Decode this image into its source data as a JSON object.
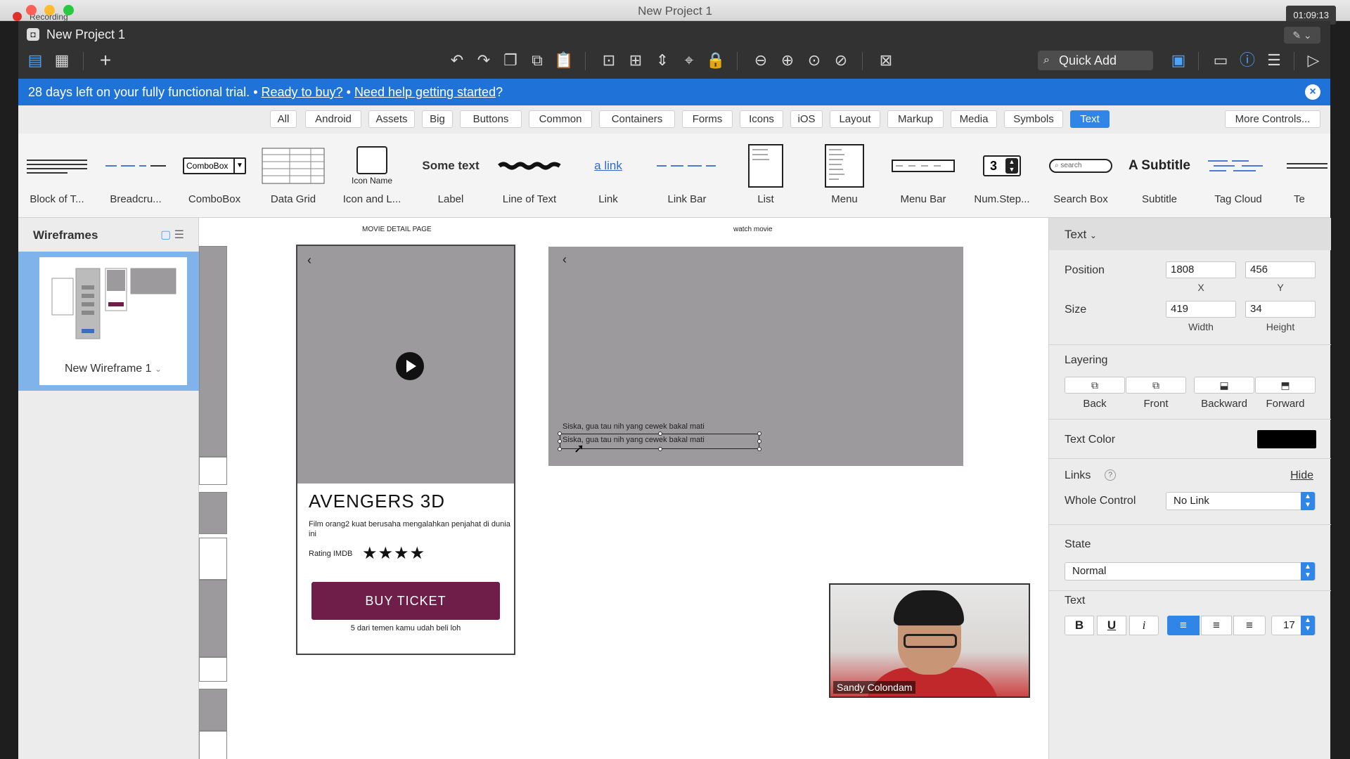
{
  "titlebar": {
    "recording": "Recording",
    "title": "New Project 1",
    "clock": "01:09:13"
  },
  "header": {
    "project_title": "New Project 1",
    "quick_add": "Quick Add",
    "edit_icon": "pencil-icon"
  },
  "trial": {
    "text": "28 days left on your fully functional trial.",
    "sep1": "•",
    "buy": "Ready to buy?",
    "sep2": "•",
    "help": "Need help getting started",
    "help_q": "?"
  },
  "filters": {
    "items": [
      "All",
      "Android",
      "Assets",
      "Big",
      "Buttons",
      "Common",
      "Containers",
      "Forms",
      "Icons",
      "iOS",
      "Layout",
      "Markup",
      "Media",
      "Symbols",
      "Text"
    ],
    "active": "Text",
    "more": "More Controls..."
  },
  "library": {
    "items": [
      {
        "label": "Block of T..."
      },
      {
        "label": "Breadcru..."
      },
      {
        "label": "ComboBox",
        "thumb": "ComboBox"
      },
      {
        "label": "Data Grid"
      },
      {
        "label": "Icon and L...",
        "thumb": "Icon Name"
      },
      {
        "label": "Label",
        "thumb": "Some text"
      },
      {
        "label": "Line of Text"
      },
      {
        "label": "Link",
        "thumb": "a link"
      },
      {
        "label": "Link Bar"
      },
      {
        "label": "List"
      },
      {
        "label": "Menu"
      },
      {
        "label": "Menu Bar"
      },
      {
        "label": "Num.Step...",
        "thumb": "3"
      },
      {
        "label": "Search Box",
        "thumb": "search"
      },
      {
        "label": "Subtitle",
        "thumb": "A Subtitle"
      },
      {
        "label": "Tag Cloud"
      },
      {
        "label": "Te"
      }
    ]
  },
  "wireframes": {
    "title": "Wireframes",
    "item": "New Wireframe 1"
  },
  "canvas": {
    "page1_title": "MOVIE DETAIL PAGE",
    "page2_title": "watch movie",
    "movie_title": "AVENGERS 3D",
    "movie_desc": "Film orang2 kuat berusaha mengalahkan penjahat di dunia ini",
    "rating_label": "Rating IMDB",
    "stars": "★★★★",
    "buy_label": "BUY TICKET",
    "friends": "5 dari temen kamu udah beli loh",
    "subtitle1": "Siska, gua tau nih yang cewek bakal mati",
    "subtitle2": "Siska, gua tau nih yang cewek bakal mati",
    "back": "‹",
    "webcam_name": "Sandy Colondam"
  },
  "inspector": {
    "title": "Text",
    "position_label": "Position",
    "x": "1808",
    "y": "456",
    "x_label": "X",
    "y_label": "Y",
    "size_label": "Size",
    "width": "419",
    "height": "34",
    "width_label": "Width",
    "height_label": "Height",
    "layering_label": "Layering",
    "layer_buttons": [
      "Back",
      "Front",
      "Backward",
      "Forward"
    ],
    "text_color_label": "Text Color",
    "text_color": "#000000",
    "links_label": "Links",
    "help": "?",
    "hide": "Hide",
    "whole_control_label": "Whole Control",
    "whole_control_value": "No Link",
    "state_label": "State",
    "state_value": "Normal",
    "text_label": "Text",
    "bold": "B",
    "underline": "U",
    "italic": "i",
    "font_size": "17"
  },
  "colors": {
    "accent": "#2f86e6",
    "banner": "#1f73d8",
    "buy_button": "#6e1e48"
  }
}
